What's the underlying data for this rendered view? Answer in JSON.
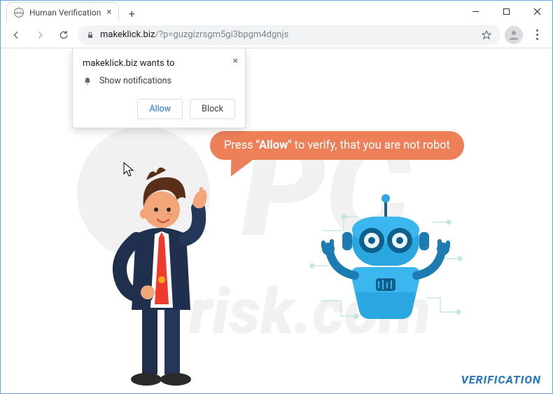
{
  "tab": {
    "title": "Human Verification"
  },
  "url": {
    "host": "makeklick.biz",
    "path": "/?p=guzgizrsgm5gi3bpgm4dgnjs"
  },
  "notification": {
    "heading": "makeklick.biz wants to",
    "permission_label": "Show notifications",
    "allow_label": "Allow",
    "block_label": "Block"
  },
  "bubble": {
    "prefix": "Press ",
    "emphasis": "\"Allow\"",
    "suffix": " to verify, that you are not robot"
  },
  "footer": {
    "verification": "VERIFICATION"
  },
  "colors": {
    "accent": "#ed8058",
    "link": "#1a73e8",
    "brand": "#2b7abf"
  }
}
